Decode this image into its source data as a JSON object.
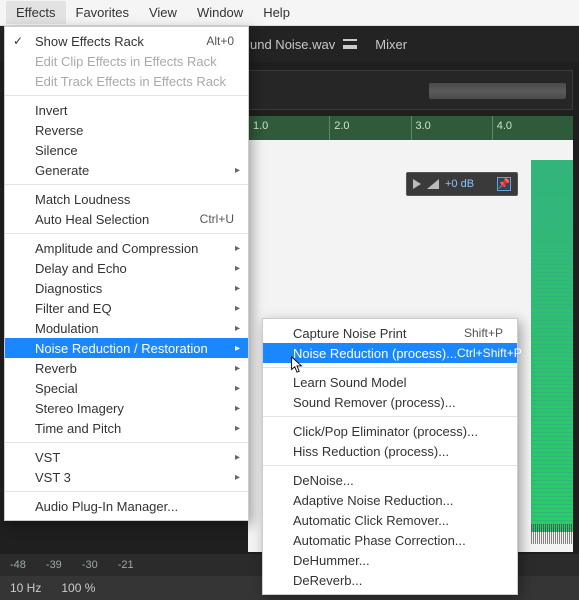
{
  "menubar": {
    "effects": "Effects",
    "favorites": "Favorites",
    "view": "View",
    "window": "Window",
    "help": "Help"
  },
  "tabbar": {
    "filename": "und Noise.wav",
    "mixer": "Mixer"
  },
  "ruler": {
    "t0": "1.0",
    "t1": "2.0",
    "t2": "3.0",
    "t3": "4.0"
  },
  "hud": {
    "db": "+0 dB",
    "pin": "📌"
  },
  "status": {
    "a": "-48",
    "b": "-39",
    "c": "-30",
    "d": "-21"
  },
  "bottom": {
    "hz": "10 Hz",
    "pct": "100 %"
  },
  "effectsMenu": {
    "showRack": "Show Effects Rack",
    "showRackKey": "Alt+0",
    "editClip": "Edit Clip Effects in Effects Rack",
    "editTrack": "Edit Track Effects in Effects Rack",
    "invert": "Invert",
    "reverse": "Reverse",
    "silence": "Silence",
    "generate": "Generate",
    "matchLoudness": "Match Loudness",
    "autoHeal": "Auto Heal Selection",
    "autoHealKey": "Ctrl+U",
    "ampComp": "Amplitude and Compression",
    "delay": "Delay and Echo",
    "diagnostics": "Diagnostics",
    "filterEQ": "Filter and EQ",
    "modulation": "Modulation",
    "noiseReduction": "Noise Reduction / Restoration",
    "reverb": "Reverb",
    "special": "Special",
    "stereo": "Stereo Imagery",
    "timePitch": "Time and Pitch",
    "vst": "VST",
    "vst3": "VST 3",
    "pluginMgr": "Audio Plug-In Manager..."
  },
  "nrSubmenu": {
    "capture": "Capture Noise Print",
    "captureKey": "Shift+P",
    "process": "Noise Reduction (process)...",
    "processKey": "Ctrl+Shift+P",
    "learn": "Learn Sound Model",
    "soundRemover": "Sound Remover (process)...",
    "clickPop": "Click/Pop Eliminator (process)...",
    "hiss": "Hiss Reduction (process)...",
    "denoise": "DeNoise...",
    "adaptive": "Adaptive Noise Reduction...",
    "autoClick": "Automatic Click Remover...",
    "autoPhase": "Automatic Phase Correction...",
    "dehummer": "DeHummer...",
    "dereverb": "DeReverb..."
  }
}
